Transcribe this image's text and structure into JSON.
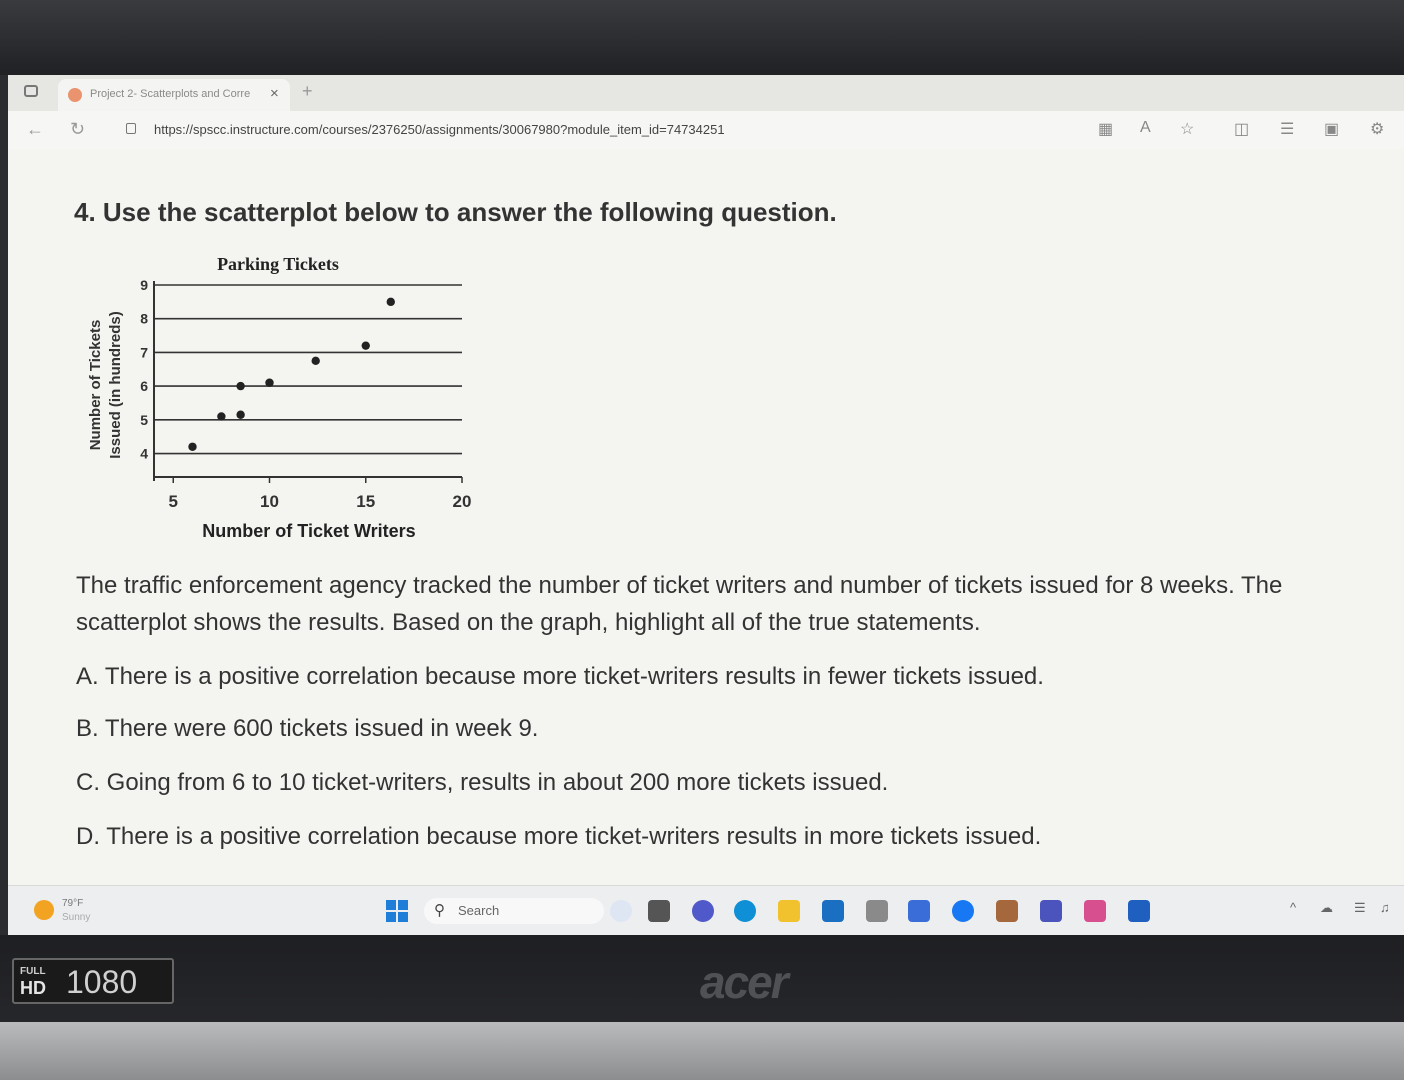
{
  "browser": {
    "tab_title": "Project 2- Scatterplots and Corre",
    "tab_close": "×",
    "new_tab": "+",
    "url": "https://spscc.instructure.com/courses/2376250/assignments/30067980?module_item_id=74734251"
  },
  "question": {
    "heading": "4. Use the scatterplot below to answer the following question.",
    "paragraph": "The traffic enforcement agency tracked the number of ticket writers and number of tickets issued for 8 weeks. The scatterplot shows the results.  Based on the graph, highlight all of the true statements.",
    "options": [
      "A. There is a positive correlation because more ticket-writers results in fewer tickets issued.",
      "B. There were 600 tickets issued in week 9.",
      "C. Going from 6 to 10 ticket-writers, results in about 200 more tickets issued.",
      "D. There is a positive correlation because more ticket-writers results in more tickets issued."
    ]
  },
  "chart_data": {
    "type": "scatter",
    "title": "Parking Tickets",
    "xlabel": "Number of Ticket Writers",
    "ylabel_line1": "Number of Tickets",
    "ylabel_line2": "Issued (in hundreds)",
    "xlim": [
      4,
      20
    ],
    "ylim": [
      3.6,
      9
    ],
    "xticks": [
      5,
      10,
      15,
      20
    ],
    "yticks": [
      4,
      5,
      6,
      7,
      8,
      9
    ],
    "grid": "horizontal",
    "points": [
      {
        "x": 6,
        "y": 4.2
      },
      {
        "x": 7.5,
        "y": 5.1
      },
      {
        "x": 8.5,
        "y": 5.15
      },
      {
        "x": 8.5,
        "y": 6
      },
      {
        "x": 10,
        "y": 6.1
      },
      {
        "x": 12.4,
        "y": 6.75
      },
      {
        "x": 15,
        "y": 7.2
      },
      {
        "x": 16.3,
        "y": 8.5
      }
    ],
    "colors": {
      "point": "#222222",
      "grid": "#333333"
    }
  },
  "taskbar": {
    "temperature": "79°F",
    "condition": "Sunny",
    "search_label": "Search"
  },
  "device": {
    "badge_full": "FULL",
    "badge_hd": "HD",
    "badge_resolution": "1080",
    "brand": "acer"
  }
}
